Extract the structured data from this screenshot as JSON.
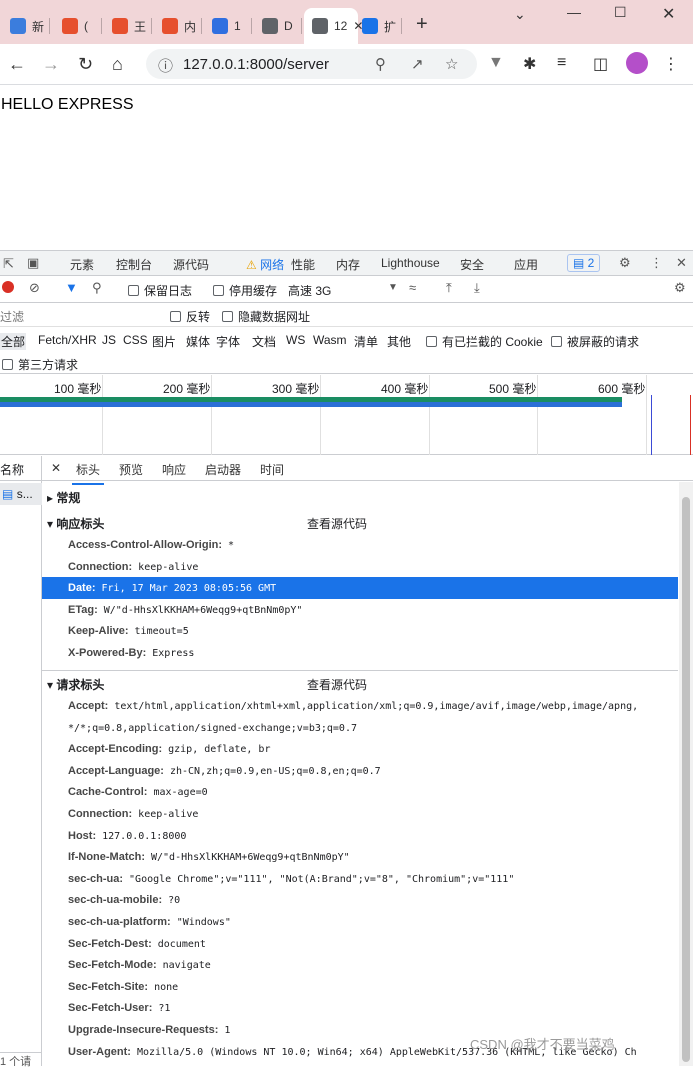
{
  "browser": {
    "tabs": [
      {
        "label": "新",
        "color": "#3b7ddd"
      },
      {
        "label": "(",
        "color": "#e6502e"
      },
      {
        "label": "王",
        "color": "#e6502e"
      },
      {
        "label": "内",
        "color": "#e6502e"
      },
      {
        "label": "1",
        "color": "#2f6fe0"
      },
      {
        "label": "D",
        "color": "#5f6368"
      },
      {
        "label": "12",
        "color": "#5f6368"
      },
      {
        "label": "扩",
        "color": "#1a73e8"
      }
    ],
    "url": "127.0.0.1:8000/server"
  },
  "page": {
    "text": "HELLO EXPRESS"
  },
  "devtools": {
    "tabs": [
      "元素",
      "控制台",
      "源代码",
      "网络",
      "性能",
      "内存",
      "Lighthouse",
      "安全",
      "应用"
    ],
    "issues_count": "2",
    "toolbar": {
      "preserve_log": "保留日志",
      "disable_cache": "停用缓存",
      "throttle": "高速 3G"
    },
    "filter": {
      "placeholder": "过滤",
      "invert": "反转",
      "hide_data_urls": "隐藏数据网址"
    },
    "types": [
      "全部",
      "Fetch/XHR",
      "JS",
      "CSS",
      "图片",
      "媒体",
      "字体",
      "文档",
      "WS",
      "Wasm",
      "清单",
      "其他"
    ],
    "blocked_cookies": "有已拦截的 Cookie",
    "blocked_requests": "被屏蔽的请求",
    "third_party": "第三方请求",
    "timeline_ticks": [
      "100 毫秒",
      "200 毫秒",
      "300 毫秒",
      "400 毫秒",
      "500 毫秒",
      "600 毫秒"
    ],
    "name_header": "名称",
    "name_item": "s...",
    "name_footer": "1 个请",
    "subtabs": [
      "标头",
      "预览",
      "响应",
      "启动器",
      "时间"
    ],
    "general": "常规",
    "response_headers_title": "响应标头",
    "request_headers_title": "请求标头",
    "view_source": "查看源代码",
    "response_headers": [
      {
        "k": "Access-Control-Allow-Origin:",
        "v": "*"
      },
      {
        "k": "Connection:",
        "v": "keep-alive"
      },
      {
        "k": "Date:",
        "v": "Fri, 17 Mar 2023 08:05:56 GMT"
      },
      {
        "k": "ETag:",
        "v": "W/\"d-HhsXlKKHAM+6Weqg9+qtBnNm0pY\""
      },
      {
        "k": "Keep-Alive:",
        "v": "timeout=5"
      },
      {
        "k": "X-Powered-By:",
        "v": "Express"
      }
    ],
    "request_headers": [
      {
        "k": "Accept:",
        "v": "text/html,application/xhtml+xml,application/xml;q=0.9,image/avif,image/webp,image/apng,"
      },
      {
        "k": "",
        "v": "*/*;q=0.8,application/signed-exchange;v=b3;q=0.7"
      },
      {
        "k": "Accept-Encoding:",
        "v": "gzip, deflate, br"
      },
      {
        "k": "Accept-Language:",
        "v": "zh-CN,zh;q=0.9,en-US;q=0.8,en;q=0.7"
      },
      {
        "k": "Cache-Control:",
        "v": "max-age=0"
      },
      {
        "k": "Connection:",
        "v": "keep-alive"
      },
      {
        "k": "Host:",
        "v": "127.0.0.1:8000"
      },
      {
        "k": "If-None-Match:",
        "v": "W/\"d-HhsXlKKHAM+6Weqg9+qtBnNm0pY\""
      },
      {
        "k": "sec-ch-ua:",
        "v": "\"Google Chrome\";v=\"111\", \"Not(A:Brand\";v=\"8\", \"Chromium\";v=\"111\""
      },
      {
        "k": "sec-ch-ua-mobile:",
        "v": "?0"
      },
      {
        "k": "sec-ch-ua-platform:",
        "v": "\"Windows\""
      },
      {
        "k": "Sec-Fetch-Dest:",
        "v": "document"
      },
      {
        "k": "Sec-Fetch-Mode:",
        "v": "navigate"
      },
      {
        "k": "Sec-Fetch-Site:",
        "v": "none"
      },
      {
        "k": "Sec-Fetch-User:",
        "v": "?1"
      },
      {
        "k": "Upgrade-Insecure-Requests:",
        "v": "1"
      },
      {
        "k": "User-Agent:",
        "v": "Mozilla/5.0 (Windows NT 10.0; Win64; x64) AppleWebKit/537.36 (KHTML, like Gecko) Ch"
      }
    ]
  },
  "watermark": "CSDN @我才不要当菜鸡"
}
